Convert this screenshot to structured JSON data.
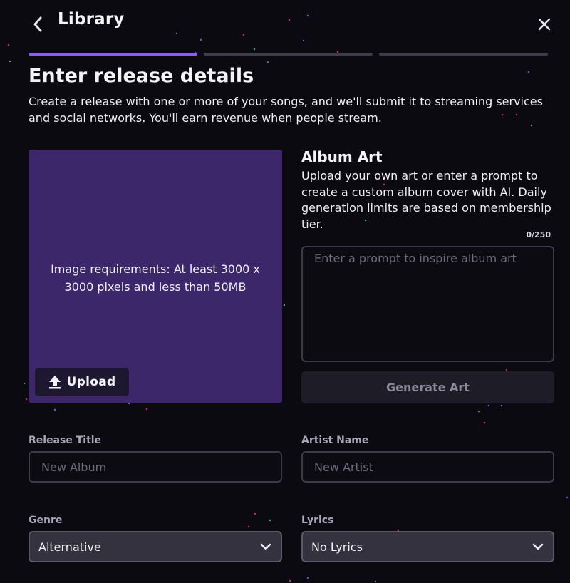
{
  "header": {
    "title": "Library",
    "back_icon": "chevron-left-icon",
    "close_icon": "close-icon"
  },
  "progress": {
    "total_steps": 3,
    "current_step": 1,
    "active_color": "#8b5cf6",
    "inactive_color": "#3e3b4a"
  },
  "intro": {
    "title": "Enter release details",
    "description": "Create a release with one or more of your songs, and we'll submit it to streaming services and social networks. You'll earn revenue when people stream."
  },
  "art_upload": {
    "requirements": "Image requirements: At least 3000 x 3000 pixels and less than 50MB",
    "upload_label": "Upload",
    "upload_icon": "upload-icon",
    "panel_color": "#3b2769"
  },
  "album_art": {
    "title": "Album Art",
    "description": "Upload your own art or enter a prompt to create a custom album cover with AI. Daily generation limits are based on membership tier.",
    "char_count": "0/250",
    "prompt_value": "",
    "prompt_placeholder": "Enter a prompt to inspire album art",
    "generate_label": "Generate Art"
  },
  "form": {
    "release_title": {
      "label": "Release Title",
      "value": "",
      "placeholder": "New Album"
    },
    "artist_name": {
      "label": "Artist Name",
      "value": "",
      "placeholder": "New Artist"
    },
    "genre": {
      "label": "Genre",
      "selected": "Alternative"
    },
    "lyrics": {
      "label": "Lyrics",
      "selected": "No Lyrics"
    }
  }
}
